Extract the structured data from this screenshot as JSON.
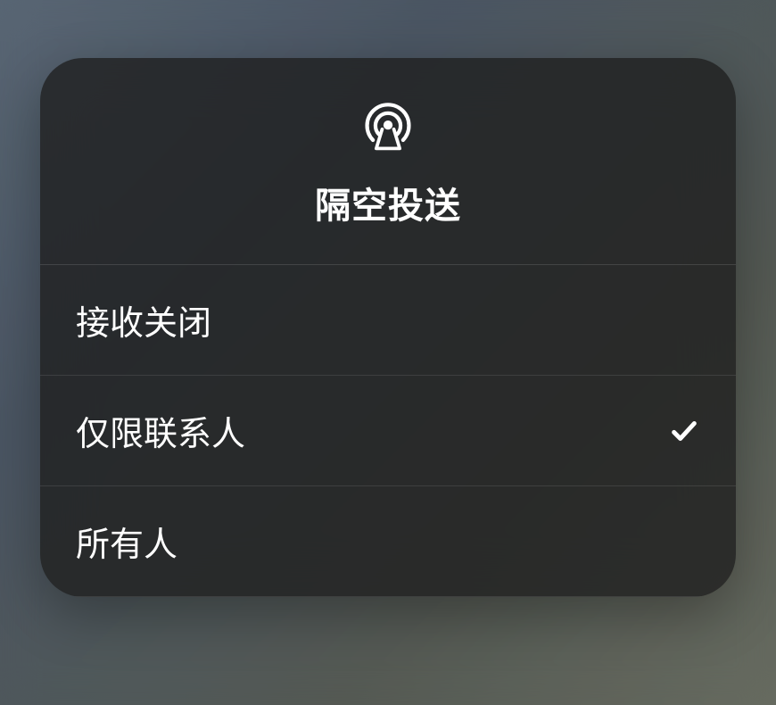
{
  "header": {
    "title": "隔空投送",
    "icon_name": "airdrop-icon"
  },
  "options": [
    {
      "label": "接收关闭",
      "selected": false
    },
    {
      "label": "仅限联系人",
      "selected": true
    },
    {
      "label": "所有人",
      "selected": false
    }
  ]
}
